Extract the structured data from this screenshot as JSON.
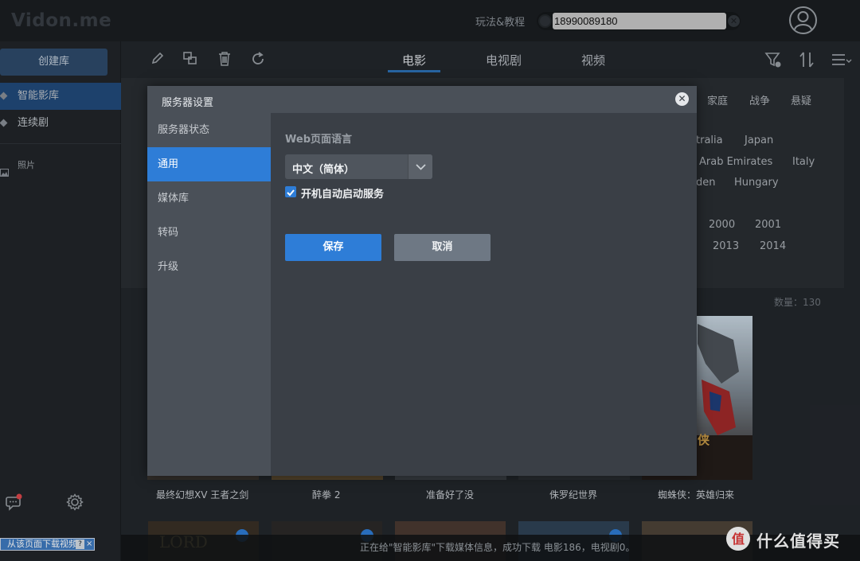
{
  "header": {
    "logo": "Vidon.me",
    "tutorial_link": "玩法&教程",
    "search_value": "18990089180"
  },
  "sidebar": {
    "create_label": "创建库",
    "items": [
      {
        "label": "智能影库",
        "active": true
      },
      {
        "label": "连续剧",
        "active": false
      },
      {
        "label": "照片",
        "active": false
      }
    ]
  },
  "tabs": [
    {
      "label": "电影",
      "active": true
    },
    {
      "label": "电视剧",
      "active": false
    },
    {
      "label": "视频",
      "active": false
    }
  ],
  "filters": {
    "genres": [
      "家庭",
      "战争",
      "悬疑"
    ],
    "countries_row1": [
      "tralia",
      "Japan"
    ],
    "countries_row2": [
      "Arab Emirates",
      "Italy"
    ],
    "countries_row3": [
      "den",
      "Hungary"
    ],
    "years_row1": [
      "2000",
      "2001"
    ],
    "years_row2": [
      "2013",
      "2014"
    ]
  },
  "count_text": "数量：130",
  "movies": [
    "最终幻想XV 王者之剑",
    "醉拳 2",
    "准备好了没",
    "侏罗纪世界",
    "蜘蛛侠：英雄归来"
  ],
  "poster_text": {
    "spiderman": "侠"
  },
  "status_text": "正在给\"智能影库\"下载媒体信息，成功下载 电影186，电视剧0。",
  "download_bar": {
    "label": "从该页面下载视频",
    "help": "?",
    "close": "×"
  },
  "watermark": "什么值得买",
  "dialog": {
    "title": "服务器设置",
    "nav": [
      {
        "label": "服务器状态",
        "active": false
      },
      {
        "label": "通用",
        "active": true
      },
      {
        "label": "媒体库",
        "active": false
      },
      {
        "label": "转码",
        "active": false
      },
      {
        "label": "升级",
        "active": false
      }
    ],
    "lang_label": "Web页面语言",
    "lang_value": "中文（简体）",
    "autostart_label": "开机自动启动服务",
    "autostart_checked": true,
    "save_label": "保存",
    "cancel_label": "取消"
  },
  "colors": {
    "accent": "#2e7dd7",
    "sidebar_active": "#214a7c",
    "background": "#23272c"
  }
}
